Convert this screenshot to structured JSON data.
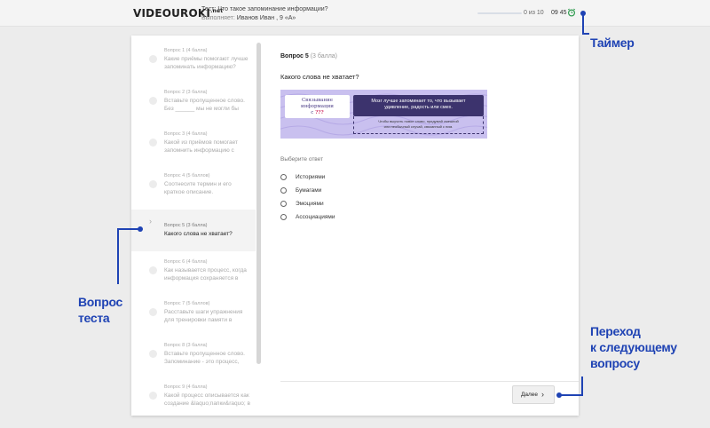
{
  "header": {
    "logo": "VIDEOUROKI",
    "logo_suffix": ".net",
    "test_label": "Тест: Что такое запоминание информации?",
    "performer_label": "Выполняет:",
    "performer_value": "Иванов Иван , 9 «А»",
    "progress_text": "0 из 10",
    "progress_fraction": 0.0,
    "timer": "09 45"
  },
  "sidebar": {
    "items": [
      {
        "head": "Вопрос 1 (4 балла)",
        "text": "Какие приёмы помогают лучше запоминать информацию?"
      },
      {
        "head": "Вопрос 2 (3 балла)",
        "text": "Вставьте пропущенное слово. Без ______ мы не могли бы"
      },
      {
        "head": "Вопрос 3 (4 балла)",
        "text": "Какой из приёмов помогает запомнить информацию с"
      },
      {
        "head": "Вопрос 4 (5 баллов)",
        "text": "Соотнесите термин и его краткое описание."
      },
      {
        "head": "Вопрос 5 (3 балла)",
        "text": "Какого слова не хватает?"
      },
      {
        "head": "Вопрос 6 (4 балла)",
        "text": "Как называется процесс, когда информация сохраняется в"
      },
      {
        "head": "Вопрос 7 (5 баллов)",
        "text": "Расставьте шаги упражнения для тренировки памяти в"
      },
      {
        "head": "Вопрос 8 (3 балла)",
        "text": "Вставьте пропущенное слово. Запоминание - это процесс,"
      },
      {
        "head": "Вопрос 9 (4 балла)",
        "text": "Какой процесс описывается как создание &laquo;папки&raquo; в"
      }
    ]
  },
  "main": {
    "question_number": "Вопрос 5",
    "question_points": "(3 балла)",
    "question_text": "Какого слова не хватает?",
    "image": {
      "left_title_line1": "Связывание",
      "left_title_line2": "информации",
      "left_title_line3": "с",
      "left_qmarks": "???",
      "right_line1": "Мозг лучше запоминает то, что вызывает",
      "right_line2": "удивление, радость или смех.",
      "bottom_line1": "Чтобы выучить новое слово, придумай смешной",
      "bottom_line2": "или необычный случай, связанный с ним."
    },
    "choose_label": "Выберите ответ",
    "options": [
      "Историями",
      "Бумагами",
      "Эмоциями",
      "Ассоциациями"
    ],
    "next_label": "Далее"
  },
  "annotations": {
    "timer": "Таймер",
    "question_line1": "Вопрос",
    "question_line2": "теста",
    "next_line1": "Переход",
    "next_line2": "к следующему",
    "next_line3": "вопросу"
  },
  "colors": {
    "annotation": "#1f43b4",
    "image_bg": "#c9c0ef",
    "image_dark": "#3c336d",
    "timer_icon": "#2e9b4e"
  }
}
